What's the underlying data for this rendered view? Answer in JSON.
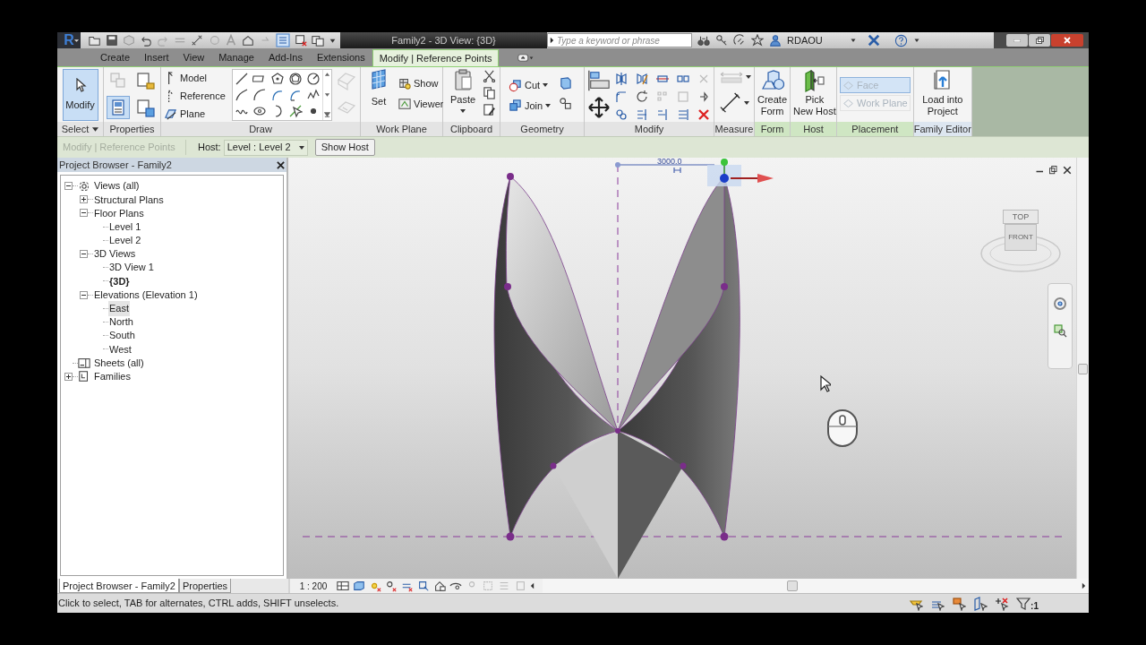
{
  "title_bar": {
    "logo": "R",
    "title": "Family2 - 3D View: {3D}",
    "search": {
      "placeholder": "Type a keyword or phrase"
    },
    "user": "RDAOU"
  },
  "ribbon_tabs": [
    {
      "label": "Create",
      "selected": false
    },
    {
      "label": "Insert",
      "selected": false
    },
    {
      "label": "View",
      "selected": false
    },
    {
      "label": "Manage",
      "selected": false
    },
    {
      "label": "Add-Ins",
      "selected": false
    },
    {
      "label": "Extensions",
      "selected": false
    },
    {
      "label": "Modify | Reference Points",
      "selected": true
    }
  ],
  "ribbon": {
    "select": {
      "title": "Select",
      "button": {
        "label": "Modify",
        "selected": true
      }
    },
    "properties": {
      "title": "Properties",
      "buttons": [
        {
          "selected": false
        },
        {
          "selected": false
        },
        {
          "selected": true
        },
        {
          "selected": false
        }
      ]
    },
    "draw": {
      "title": "Draw",
      "modes": [
        "Model",
        "Reference",
        "Plane"
      ]
    },
    "work_plane": {
      "title": "Work Plane",
      "set": "Set",
      "show": "Show",
      "viewer": "Viewer"
    },
    "clipboard": {
      "title": "Clipboard",
      "paste": "Paste"
    },
    "geometry": {
      "title": "Geometry",
      "cut": "Cut",
      "join": "Join"
    },
    "modify": {
      "title": "Modify"
    },
    "measure": {
      "title": "Measure"
    },
    "form": {
      "title": "Form",
      "button": [
        "Create",
        "Form"
      ]
    },
    "host": {
      "title": "Host",
      "button": [
        "Pick",
        "New Host"
      ]
    },
    "placement": {
      "title": "Placement",
      "options": [
        {
          "label": "Face",
          "selected": true,
          "disabled": true
        },
        {
          "label": "Work Plane",
          "selected": false,
          "disabled": true
        }
      ]
    },
    "family_editor": {
      "title": "Family Editor",
      "button": [
        "Load into",
        "Project"
      ]
    }
  },
  "options_bar": {
    "context": "Modify | Reference Points",
    "host_label": "Host:",
    "host_value": "Level : Level 2",
    "show_host": "Show Host"
  },
  "project_browser": {
    "title": "Project Browser - Family2",
    "tree": [
      {
        "label": "Views (all)",
        "kind": "views",
        "expanded": true,
        "selected": false,
        "current": false,
        "children": [
          {
            "label": "Structural Plans",
            "expanded": false,
            "selected": false,
            "current": false
          },
          {
            "label": "Floor Plans",
            "expanded": true,
            "selected": false,
            "current": false,
            "children": [
              {
                "label": "Level 1",
                "selected": false,
                "current": false
              },
              {
                "label": "Level 2",
                "selected": false,
                "current": false
              }
            ]
          },
          {
            "label": "3D Views",
            "expanded": true,
            "selected": false,
            "current": false,
            "children": [
              {
                "label": "3D View 1",
                "selected": false,
                "current": false
              },
              {
                "label": "{3D}",
                "selected": false,
                "current": true
              }
            ]
          },
          {
            "label": "Elevations (Elevation 1)",
            "expanded": true,
            "selected": false,
            "current": false,
            "children": [
              {
                "label": "East",
                "selected": true,
                "current": false
              },
              {
                "label": "North",
                "selected": false,
                "current": false
              },
              {
                "label": "South",
                "selected": false,
                "current": false
              },
              {
                "label": "West",
                "selected": false,
                "current": false
              }
            ]
          }
        ]
      },
      {
        "label": "Sheets (all)",
        "kind": "sheets",
        "selected": false,
        "current": false
      },
      {
        "label": "Families",
        "kind": "families",
        "expanded": false,
        "selected": false,
        "current": false
      }
    ]
  },
  "bottom_tabs": [
    {
      "label": "Project Browser - Family2",
      "selected": true
    },
    {
      "label": "Properties",
      "selected": false
    }
  ],
  "viewport": {
    "dimension": "3000.0",
    "view_cube": {
      "top": "TOP",
      "front": "FRONT"
    }
  },
  "view_control_bar": {
    "scale": "1 : 200"
  },
  "status_bar": {
    "message": "Click to select, TAB for alternates, CTRL adds, SHIFT unselects.",
    "filter_count": ":1"
  }
}
